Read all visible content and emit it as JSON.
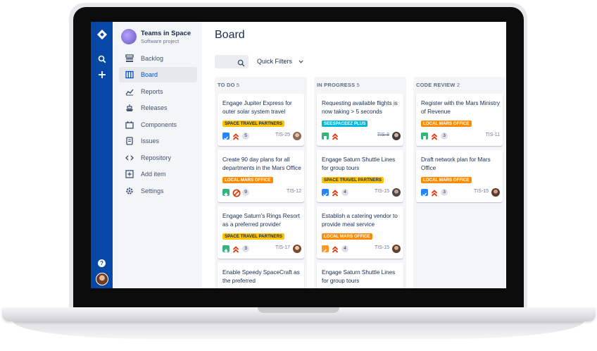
{
  "app": {
    "project": {
      "name": "Teams in Space",
      "type": "Software project"
    },
    "nav_items": [
      {
        "label": "Backlog",
        "icon": "backlog-icon"
      },
      {
        "label": "Board",
        "icon": "board-icon",
        "active": true
      },
      {
        "label": "Reports",
        "icon": "reports-icon"
      },
      {
        "label": "Releases",
        "icon": "releases-icon"
      },
      {
        "label": "Components",
        "icon": "components-icon"
      },
      {
        "label": "Issues",
        "icon": "issues-icon"
      },
      {
        "label": "Repository",
        "icon": "repository-icon"
      },
      {
        "label": "Add item",
        "icon": "add-item-icon"
      },
      {
        "label": "Settings",
        "icon": "settings-icon"
      }
    ],
    "global_nav": {
      "help": "?"
    }
  },
  "board": {
    "title": "Board",
    "quick_filters": "Quick Filters",
    "columns": [
      {
        "name": "TO DO",
        "count": "5"
      },
      {
        "name": "IN PROGRESS",
        "count": "5"
      },
      {
        "name": "CODE REVIEW",
        "count": "2"
      }
    ],
    "cards": [
      {
        "title": "Engage Jupiter Express for outer solar system travel",
        "epic": "SPACE TRAVEL PARTNERS",
        "count": "5",
        "key": "TIS-25"
      },
      {
        "title": "Create 90 day plans for all departments in the Mars Office",
        "epic": "LOCAL MARS OFFICE",
        "count": "9",
        "key": "TIS-12"
      },
      {
        "title": "Engage Saturn's Rings Resort as a preferred provider",
        "epic": "SPACE TRAVEL PARTNERS",
        "count": "3",
        "key": "TIS-17"
      },
      {
        "title": "Enable Speedy SpaceCraft as the preferred",
        "epic": "",
        "count": "",
        "key": ""
      },
      {
        "title": "Requesting available flights is now taking > 5 seconds",
        "epic": "SEESPACEEZ PLUS",
        "count": "",
        "key": "TIS-8"
      },
      {
        "title": "Engage Saturn Shuttle Lines for group tours",
        "epic": "SPACE TRAVEL PARTNERS",
        "count": "4",
        "key": "TIS-15"
      },
      {
        "title": "Establish a catering vendor to provide meal service",
        "epic": "LOCAL MARS OFFICE",
        "count": "4",
        "key": "TIS-15"
      },
      {
        "title": "Engage Saturn Shuttle Lines for group tours",
        "epic": "",
        "count": "",
        "key": ""
      },
      {
        "title": "Register with the Mars Ministry of Revenue",
        "epic": "LOCAL MARS OFFICE",
        "count": "3",
        "key": "TIS-11"
      },
      {
        "title": "Draft network plan for Mars Office",
        "epic": "LOCAL MARS OFFICE",
        "count": "3",
        "key": "TIS-15"
      }
    ]
  },
  "colors": {
    "global_nav": "#0747a6",
    "epic_space_travel": "#ffc400",
    "epic_local_mars": "#ff8b00",
    "epic_seespaceez": "#00b8d9",
    "priority_high": "#de350b",
    "story": "#36b37e",
    "task": "#2684ff",
    "bug": "#ff5630"
  }
}
